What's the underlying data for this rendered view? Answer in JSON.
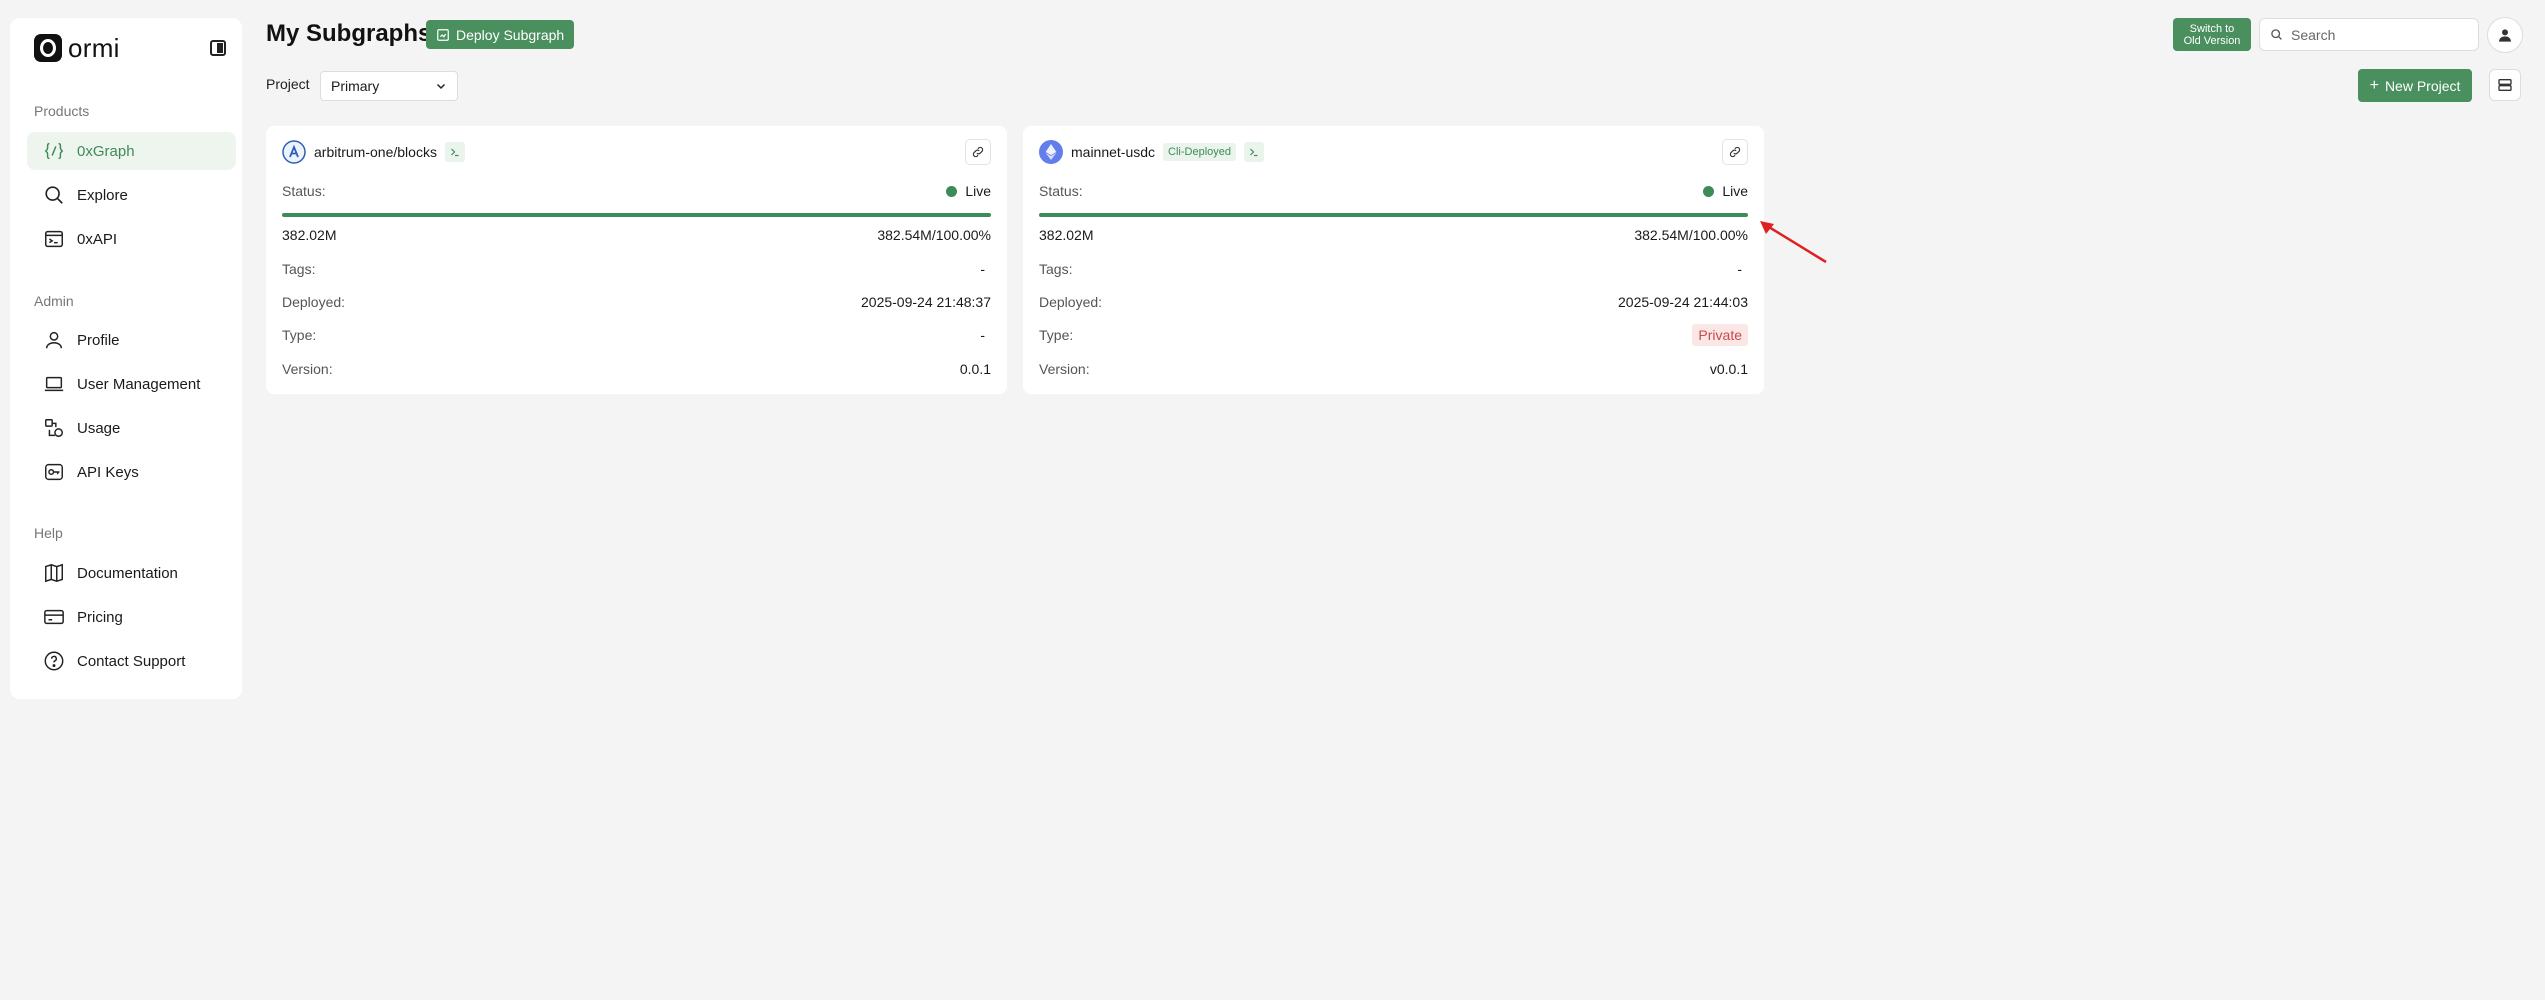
{
  "sidebar": {
    "logo_text": "ormi",
    "sections": {
      "products": "Products",
      "admin": "Admin",
      "help": "Help"
    },
    "items": [
      {
        "label": "0xGraph",
        "icon": "braces-slash-icon"
      },
      {
        "label": "Explore",
        "icon": "search-icon"
      },
      {
        "label": "0xAPI",
        "icon": "terminal-window-icon"
      },
      {
        "label": "Profile",
        "icon": "user-icon"
      },
      {
        "label": "User Management",
        "icon": "laptop-icon"
      },
      {
        "label": "Usage",
        "icon": "usage-icon"
      },
      {
        "label": "API Keys",
        "icon": "key-icon"
      },
      {
        "label": "Documentation",
        "icon": "book-icon"
      },
      {
        "label": "Pricing",
        "icon": "credit-card-icon"
      },
      {
        "label": "Contact Support",
        "icon": "help-circle-icon"
      }
    ]
  },
  "header": {
    "title": "My Subgraphs",
    "deploy_label": "Deploy Subgraph",
    "switch_label_1": "Switch to",
    "switch_label_2": "Old Version",
    "search_placeholder": "Search",
    "project_label": "Project",
    "project_value": "Primary",
    "new_project_label": "New Project"
  },
  "cards": [
    {
      "name": "arbitrum-one/blocks",
      "chain_icon": "arbitrum-icon",
      "status_label": "Status:",
      "status_value": "Live",
      "progress_fraction": 1.0,
      "current": "382.02M",
      "total": "382.54M/100.00%",
      "tags_label": "Tags:",
      "tags_value": "-",
      "deployed_label": "Deployed:",
      "deployed_value": "2025-09-24 21:48:37",
      "type_label": "Type:",
      "type_value": "-",
      "version_label": "Version:",
      "version_value": "0.0.1"
    },
    {
      "name": "mainnet-usdc",
      "badge": "Cli-Deployed",
      "chain_icon": "ethereum-icon",
      "status_label": "Status:",
      "status_value": "Live",
      "progress_fraction": 1.0,
      "current": "382.02M",
      "total": "382.54M/100.00%",
      "tags_label": "Tags:",
      "tags_value": "-",
      "deployed_label": "Deployed:",
      "deployed_value": "2025-09-24 21:44:03",
      "type_label": "Type:",
      "type_value": "Private",
      "version_label": "Version:",
      "version_value": "v0.0.1"
    }
  ],
  "colors": {
    "accent": "#4a8f5e",
    "live": "#3d8b57",
    "private_text": "#c84a4a",
    "annotation_arrow": "#e02020"
  }
}
